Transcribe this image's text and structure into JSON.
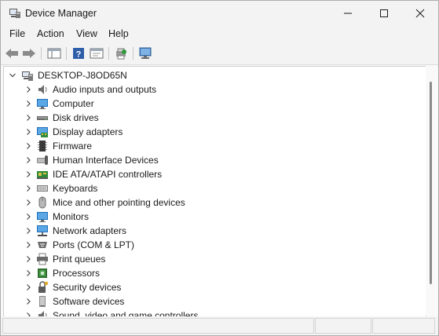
{
  "window": {
    "title": "Device Manager"
  },
  "menu": {
    "file": "File",
    "action": "Action",
    "view": "View",
    "help": "Help"
  },
  "tree": {
    "root": "DESKTOP-J8OD65N",
    "items": [
      {
        "label": "Audio inputs and outputs",
        "icon": "speaker-icon"
      },
      {
        "label": "Computer",
        "icon": "computer-icon"
      },
      {
        "label": "Disk drives",
        "icon": "disk-drive-icon"
      },
      {
        "label": "Display adapters",
        "icon": "display-adapter-icon"
      },
      {
        "label": "Firmware",
        "icon": "firmware-chip-icon"
      },
      {
        "label": "Human Interface Devices",
        "icon": "hid-icon"
      },
      {
        "label": "IDE ATA/ATAPI controllers",
        "icon": "ide-controller-icon"
      },
      {
        "label": "Keyboards",
        "icon": "keyboard-icon"
      },
      {
        "label": "Mice and other pointing devices",
        "icon": "mouse-icon"
      },
      {
        "label": "Monitors",
        "icon": "monitor-icon"
      },
      {
        "label": "Network adapters",
        "icon": "network-adapter-icon"
      },
      {
        "label": "Ports (COM & LPT)",
        "icon": "port-icon"
      },
      {
        "label": "Print queues",
        "icon": "printer-icon"
      },
      {
        "label": "Processors",
        "icon": "processor-icon"
      },
      {
        "label": "Security devices",
        "icon": "security-key-icon"
      },
      {
        "label": "Software devices",
        "icon": "software-device-icon"
      },
      {
        "label": "Sound, video and game controllers",
        "icon": "sound-controller-icon"
      }
    ]
  }
}
